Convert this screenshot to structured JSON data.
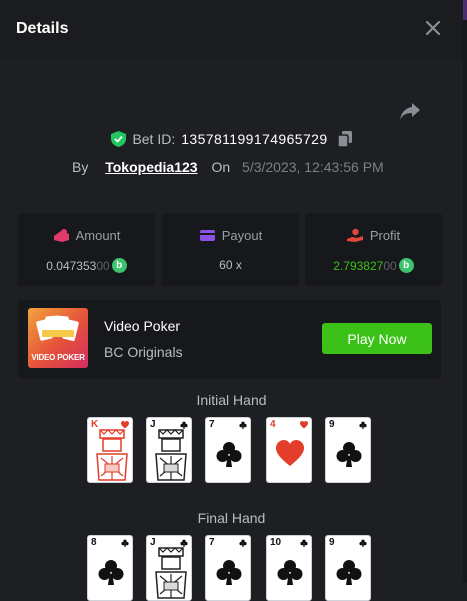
{
  "header": {
    "title": "Details",
    "close_icon": "close-icon"
  },
  "bet": {
    "label": "Bet ID:",
    "id": "135781199174965729",
    "by_label": "By",
    "username": "Tokopedia123",
    "on_label": "On",
    "datetime": "5/3/2023, 12:43:56 PM"
  },
  "stats": {
    "amount": {
      "label": "Amount",
      "value_main": "0.047353",
      "value_dim": "00",
      "coin": "b"
    },
    "payout": {
      "label": "Payout",
      "value": "60 x"
    },
    "profit": {
      "label": "Profit",
      "value_main": "2.793827",
      "value_dim": "00",
      "coin": "b"
    }
  },
  "game": {
    "name": "Video Poker",
    "provider": "BC Originals",
    "thumb_text": "VIDEO POKER",
    "play_label": "Play Now"
  },
  "hands": {
    "initial_label": "Initial Hand",
    "final_label": "Final Hand",
    "initial": [
      {
        "rank": "K",
        "suit": "hearts",
        "color": "#e33d2c",
        "face": true
      },
      {
        "rank": "J",
        "suit": "clubs",
        "color": "#111111",
        "face": true
      },
      {
        "rank": "7",
        "suit": "clubs",
        "color": "#111111",
        "face": false
      },
      {
        "rank": "4",
        "suit": "hearts",
        "color": "#e33d2c",
        "face": false
      },
      {
        "rank": "9",
        "suit": "clubs",
        "color": "#111111",
        "face": false
      }
    ],
    "final": [
      {
        "rank": "8",
        "suit": "clubs",
        "color": "#111111",
        "face": false
      },
      {
        "rank": "J",
        "suit": "clubs",
        "color": "#111111",
        "face": true
      },
      {
        "rank": "7",
        "suit": "clubs",
        "color": "#111111",
        "face": false
      },
      {
        "rank": "10",
        "suit": "clubs",
        "color": "#111111",
        "face": false
      },
      {
        "rank": "9",
        "suit": "clubs",
        "color": "#111111",
        "face": false
      }
    ]
  },
  "colors": {
    "accent_green": "#3bc117",
    "profit_green": "#3bc46d",
    "shield_green": "#22c55e"
  }
}
